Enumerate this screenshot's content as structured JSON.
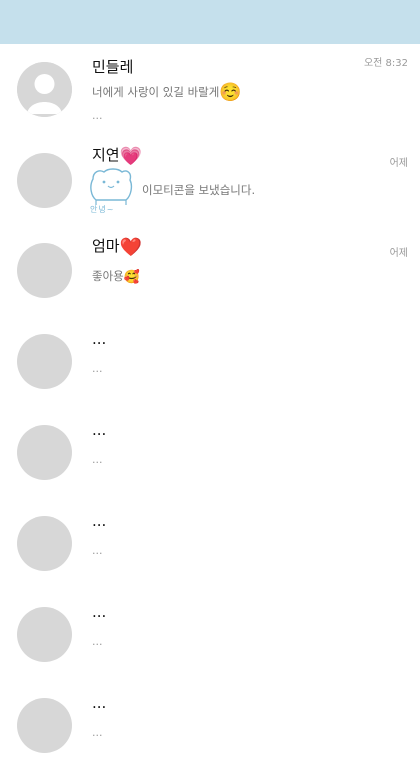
{
  "header": {},
  "chats": [
    {
      "name": "민들레",
      "name_emoji": "",
      "message": "너에게 사랑이 있길 바랄게",
      "message_emoji": "☺️",
      "preview": "...",
      "time": "오전 8:32"
    },
    {
      "name": "지연",
      "name_emoji": "💗",
      "message": "이모티콘을 보냈습니다.",
      "sticker_caption": "안녕~",
      "time": "어제",
      "sticker_icon": "bear-sticker-icon"
    },
    {
      "name": "엄마",
      "name_emoji": "❤️",
      "message": "좋아용",
      "message_emoji": "🥰",
      "time": "어제"
    },
    {
      "name": "...",
      "message": "..."
    },
    {
      "name": "...",
      "message": "..."
    },
    {
      "name": "...",
      "message": "..."
    },
    {
      "name": "...",
      "message": "..."
    },
    {
      "name": "...",
      "message": "..."
    }
  ],
  "colors": {
    "header_bg": "#c5e0ec",
    "avatar_bg": "#d7d7d7",
    "sticker_line": "#7ab8d6"
  }
}
